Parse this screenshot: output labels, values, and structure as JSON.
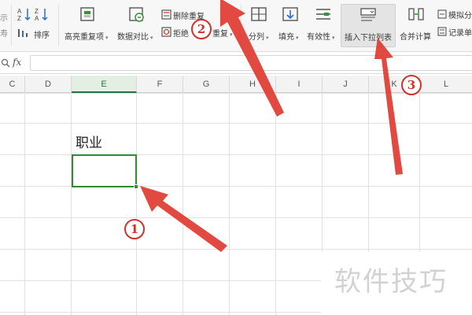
{
  "ribbon": {
    "left_partial_1": "示",
    "left_partial_2": "寿",
    "sort_label": "排序",
    "highlight_duplicates_label": "高亮重复项",
    "data_compare_label": "数据对比",
    "delete_duplicates_label": "删除重复",
    "reject_duplicates_label": "拒绝",
    "partial_duplicates_text": "重复",
    "split_label": "分列",
    "fill_label": "填充",
    "validity_label": "有效性",
    "insert_dropdown_list_label": "插入下拉列表",
    "merge_calc_label": "合并计算",
    "simulate_label": "模拟分",
    "record_label": "记录单"
  },
  "formula_bar": {
    "fx_label": "fx",
    "value": ""
  },
  "column_headers": [
    "C",
    "D",
    "E",
    "F",
    "G",
    "H",
    "I",
    "J",
    "K",
    "L"
  ],
  "active_column": "E",
  "cells": {
    "e4": "职业",
    "e5": ""
  },
  "annotations": {
    "step1": "1",
    "step2": "2",
    "step3": "3",
    "arrow_color": "#e03a30"
  },
  "watermark": "软件技巧"
}
